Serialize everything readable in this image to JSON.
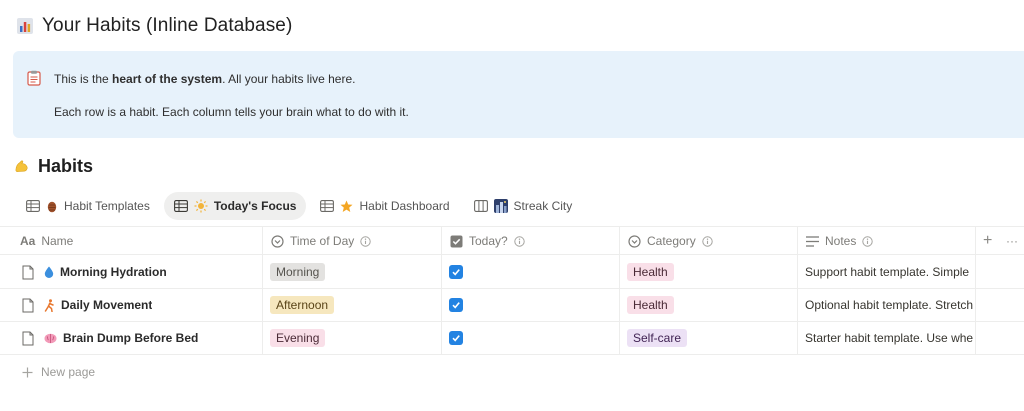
{
  "page": {
    "title": "Your Habits (Inline Database)"
  },
  "callout": {
    "line1_prefix": "This is the ",
    "line1_bold": "heart of the system",
    "line1_suffix": ". All your habits live here.",
    "line2": "Each row is a habit. Each column tells your brain what to do with it."
  },
  "section": {
    "title": "Habits"
  },
  "tabs": [
    {
      "label": "Habit Templates"
    },
    {
      "label": "Today's Focus",
      "active": true
    },
    {
      "label": "Habit Dashboard"
    },
    {
      "label": "Streak City"
    }
  ],
  "columns": {
    "name": "Name",
    "time": "Time of Day",
    "today": "Today?",
    "category": "Category",
    "notes": "Notes",
    "add": "+",
    "more": "···"
  },
  "rows": [
    {
      "name": "Morning Hydration",
      "time": "Morning",
      "today": true,
      "category": "Health",
      "notes": "Support habit template. Simple"
    },
    {
      "name": "Daily Movement",
      "time": "Afternoon",
      "today": true,
      "category": "Health",
      "notes": "Optional habit template. Stretch"
    },
    {
      "name": "Brain Dump Before Bed",
      "time": "Evening",
      "today": true,
      "category": "Self-care",
      "notes": "Starter habit template. Use whe"
    }
  ],
  "new_page": "New page",
  "colors": {
    "callout_bg": "#e7f2fb",
    "checkbox": "#2383e2",
    "tag_morning_bg": "#e3e2e0",
    "tag_afternoon_bg": "#f6e7be",
    "tag_evening_bg": "#f9dfe8",
    "tag_health_bg": "#f9dfe8",
    "tag_selfcare_bg": "#ece1f5"
  },
  "icons": {
    "page": "bar-chart-icon",
    "callout": "clipboard-icon",
    "section": "flexed-biceps-icon",
    "row_icons": [
      "droplet-icon",
      "running-person-icon",
      "brain-icon"
    ]
  }
}
